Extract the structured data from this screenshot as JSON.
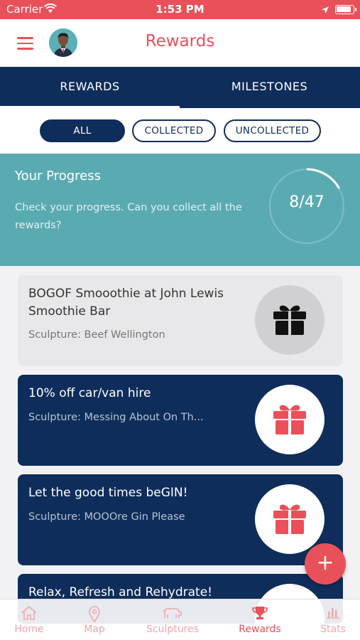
{
  "status_bar": {
    "carrier": "Carrier",
    "time": "1:53 PM"
  },
  "header": {
    "title": "Rewards"
  },
  "tabs": [
    {
      "label": "REWARDS",
      "active": true
    },
    {
      "label": "MILESTONES",
      "active": false
    }
  ],
  "filters": [
    {
      "label": "ALL",
      "active": true
    },
    {
      "label": "COLLECTED",
      "active": false
    },
    {
      "label": "UNCOLLECTED",
      "active": false
    }
  ],
  "progress": {
    "title": "Your Progress",
    "description": "Check your progress. Can you collect all the rewards?",
    "count": "8/47",
    "collected": 8,
    "total": 47
  },
  "rewards": [
    {
      "title": "BOGOF Smooothie at John Lewis Smoothie Bar",
      "sculpture": "Sculpture: Beef Wellington",
      "collected": true
    },
    {
      "title": "10% off car/van hire",
      "sculpture": "Sculpture: Messing About On Th...",
      "collected": false
    },
    {
      "title": "Let the good times beGIN!",
      "sculpture": "Sculpture: MOOOre Gin Please",
      "collected": false
    },
    {
      "title": "Relax, Refresh and Rehydrate!",
      "sculpture": "",
      "collected": false
    }
  ],
  "bottom_nav": [
    {
      "label": "Home",
      "icon": "home-icon",
      "active": false
    },
    {
      "label": "Map",
      "icon": "map-pin-icon",
      "active": false
    },
    {
      "label": "Sculptures",
      "icon": "sculpture-icon",
      "active": false
    },
    {
      "label": "Rewards",
      "icon": "trophy-icon",
      "active": true
    },
    {
      "label": "Stats",
      "icon": "stats-icon",
      "active": false
    }
  ],
  "colors": {
    "brand_red": "#e9515a",
    "navy": "#0f2d5a",
    "teal": "#5aabb1"
  }
}
